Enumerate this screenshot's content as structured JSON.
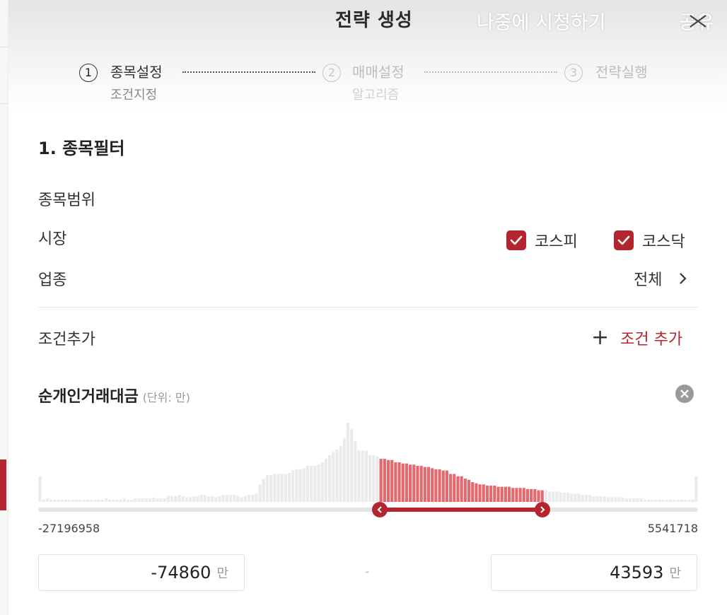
{
  "header": {
    "title": "전략 생성",
    "watch_later": "나중에 시청하기",
    "share": "공유"
  },
  "steps": [
    {
      "number": "1",
      "label": "종목설정",
      "sub": "조건지정",
      "active": true
    },
    {
      "number": "2",
      "label": "매매설정",
      "sub": "알고리즘",
      "active": false
    },
    {
      "number": "3",
      "label": "전략실행",
      "sub": "",
      "active": false
    }
  ],
  "section": {
    "title": "1. 종목필터",
    "scope_label": "종목범위",
    "market_label": "시장",
    "industry_label": "업종",
    "industry_value": "전체",
    "markets": [
      {
        "label": "코스피",
        "checked": true
      },
      {
        "label": "코스닥",
        "checked": true
      }
    ],
    "add_condition_label": "조건추가",
    "add_condition_button": "조건 추가"
  },
  "filter": {
    "name": "순개인거래대금",
    "unit_note": "(단위: 만)",
    "axis_min": "-27196958",
    "axis_max": "5541718",
    "range_min": "-74860",
    "range_max": "43593",
    "unit": "만",
    "separator": "-",
    "selected_range_fraction": [
      0.518,
      0.764
    ]
  },
  "chart_data": {
    "type": "bar",
    "title": "",
    "bins": 99,
    "values": [
      22,
      2,
      3,
      2,
      2,
      2,
      2,
      2,
      2,
      2,
      2,
      2,
      2,
      2,
      2,
      2,
      2,
      2,
      3,
      2,
      2,
      2,
      2,
      3,
      2,
      2,
      3,
      3,
      3,
      3,
      3,
      4,
      3,
      3,
      3,
      5,
      5,
      5,
      6,
      5,
      4,
      4,
      5,
      5,
      6,
      6,
      5,
      5,
      4,
      5,
      6,
      6,
      6,
      6,
      5,
      4,
      5,
      6,
      6,
      7,
      15,
      20,
      23,
      23,
      24,
      24,
      24,
      24,
      25,
      27,
      28,
      28,
      29,
      31,
      31,
      31,
      32,
      34,
      37,
      40,
      43,
      45,
      48,
      55,
      68,
      63,
      52,
      44,
      44,
      44,
      40,
      40,
      39,
      37,
      37,
      36,
      36,
      34,
      34,
      33,
      33,
      32,
      32,
      31,
      31,
      30,
      30,
      29,
      28,
      28,
      27,
      27,
      24,
      24,
      22,
      22,
      20,
      19,
      17,
      16,
      15,
      15,
      14,
      14,
      14,
      13,
      13,
      13,
      13,
      12,
      12,
      12,
      12,
      11,
      11,
      11,
      10,
      10,
      10,
      9,
      9,
      9,
      8,
      8,
      8,
      7,
      7,
      7,
      6,
      6,
      6,
      5,
      5,
      5,
      5,
      4,
      4,
      4,
      4,
      4,
      3,
      3,
      3,
      3,
      3,
      2,
      2,
      2,
      2,
      2,
      2,
      2,
      2,
      2,
      2,
      2,
      2,
      2,
      2,
      22
    ],
    "accent_color": "#e26a6f",
    "inactive_color": "#ebebeb"
  },
  "colors": {
    "accent": "#b3262f"
  }
}
